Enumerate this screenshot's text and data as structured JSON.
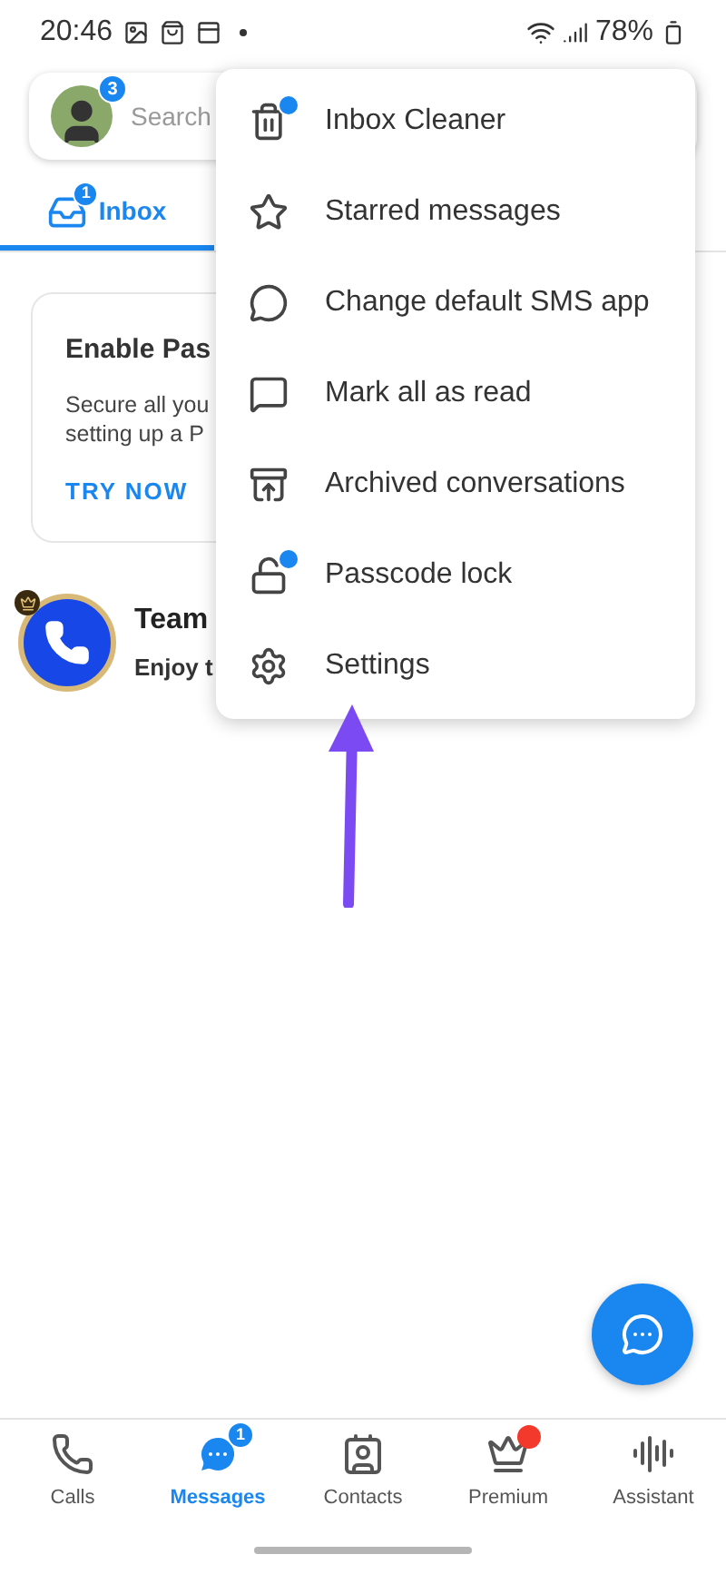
{
  "status_bar": {
    "time": "20:46",
    "battery": "78%"
  },
  "search": {
    "placeholder": "Search",
    "avatar_badge": "3"
  },
  "tabs": [
    {
      "label": "Inbox",
      "badge": "1",
      "selected": true
    }
  ],
  "promo_card": {
    "title": "Enable Pas",
    "body_lines": [
      "Secure all you",
      "setting up a P"
    ],
    "action": "TRY NOW"
  },
  "conversations": [
    {
      "name": "Team",
      "preview": "Enjoy t"
    }
  ],
  "menu": [
    {
      "label": "Inbox Cleaner",
      "new_dot": true
    },
    {
      "label": "Starred messages",
      "new_dot": false
    },
    {
      "label": "Change default SMS app",
      "new_dot": false
    },
    {
      "label": "Mark all as read",
      "new_dot": false
    },
    {
      "label": "Archived conversations",
      "new_dot": false
    },
    {
      "label": "Passcode lock",
      "new_dot": true
    },
    {
      "label": "Settings",
      "new_dot": false
    }
  ],
  "bottom_nav": [
    {
      "label": "Calls",
      "selected": false
    },
    {
      "label": "Messages",
      "selected": true,
      "badge": "1"
    },
    {
      "label": "Contacts",
      "selected": false
    },
    {
      "label": "Premium",
      "selected": false,
      "dot": true
    },
    {
      "label": "Assistant",
      "selected": false
    }
  ]
}
